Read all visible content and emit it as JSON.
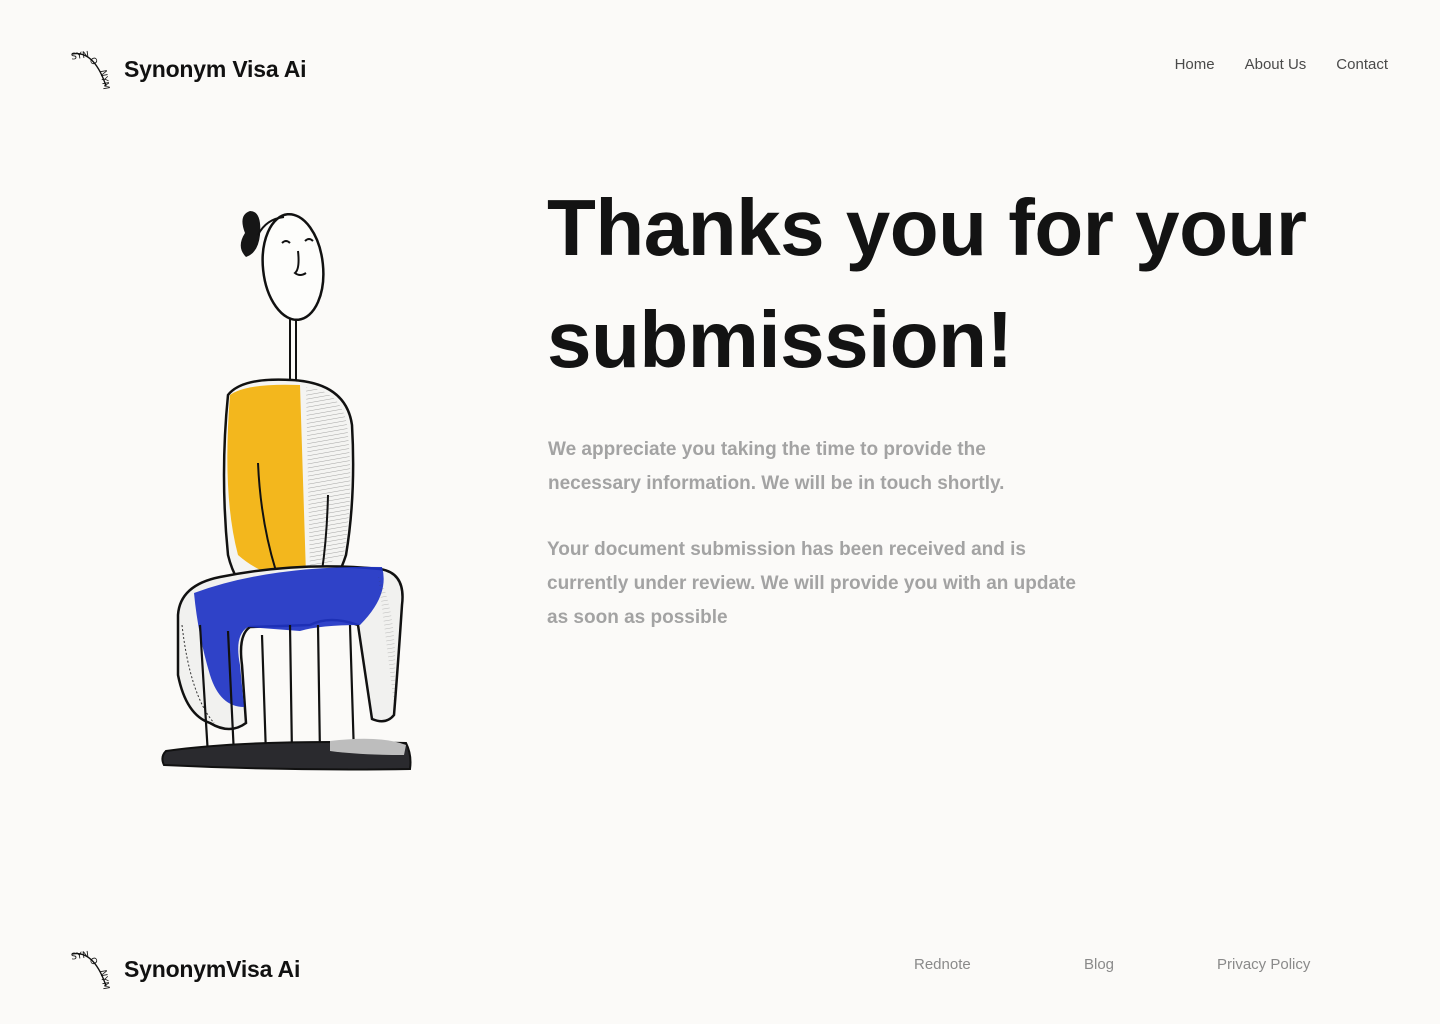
{
  "header": {
    "brand": "Synonym Visa Ai",
    "logo_text": "SYNONYM",
    "nav": [
      {
        "label": "Home"
      },
      {
        "label": "About Us"
      },
      {
        "label": "Contact"
      }
    ]
  },
  "main": {
    "headline": "Thanks you for your submission!",
    "message_1": "We appreciate you taking the time to provide the necessary information. We will be in touch shortly.",
    "message_2": "Your document submission has been received and is currently under review. We will provide you with an update as soon as possible",
    "illustration": "seated-figure-illustration"
  },
  "footer": {
    "brand": "SynonymVisa Ai",
    "logo_text": "SYNONYM",
    "links": [
      {
        "label": "Rednote"
      },
      {
        "label": "Blog"
      },
      {
        "label": "Privacy Policy"
      }
    ]
  },
  "colors": {
    "background": "#fbfaf8",
    "text": "#131313",
    "muted": "#a3a3a3",
    "accent_yellow": "#f3b71d",
    "accent_blue": "#1e33c4"
  }
}
